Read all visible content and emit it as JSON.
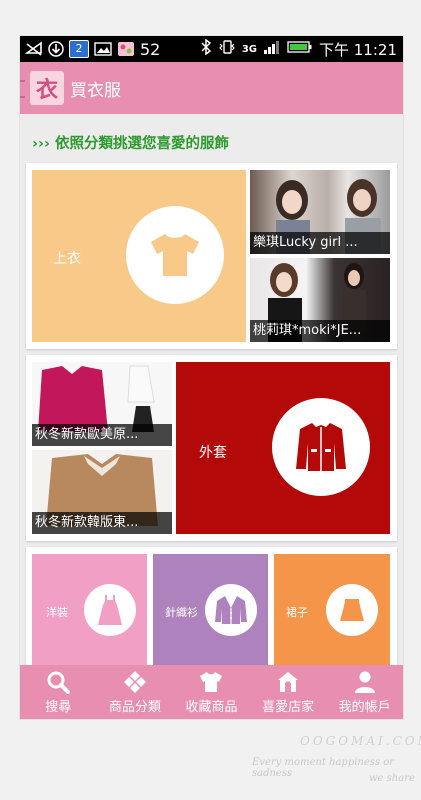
{
  "status_bar": {
    "battery_text": "52",
    "signal_label": "3G",
    "time": "下午 11:21",
    "notification_count": "2"
  },
  "app": {
    "title": "買衣服",
    "logo_char": "衣"
  },
  "section": {
    "title": "››› 依照分類挑選您喜愛的服飾"
  },
  "categories": {
    "tops": {
      "label": "上衣",
      "color": "#f9c98a",
      "shop1_caption": "樂琪Lucky girl ...",
      "shop2_caption": "桃莉琪*moki*JE..."
    },
    "jackets": {
      "label": "外套",
      "color": "#b30909",
      "shop1_caption": "秋冬新款歐美原...",
      "shop2_caption": "秋冬新款韓版東..."
    },
    "dresses": {
      "label": "洋裝",
      "color": "#f29fc6"
    },
    "cardigans": {
      "label": "針織衫",
      "color": "#ad82bd"
    },
    "skirts": {
      "label": "裙子",
      "color": "#f5954a"
    }
  },
  "bottom_nav": [
    {
      "label": "搜尋",
      "icon": "search-icon"
    },
    {
      "label": "商品分類",
      "icon": "categories-icon"
    },
    {
      "label": "收藏商品",
      "icon": "shirt-icon"
    },
    {
      "label": "喜愛店家",
      "icon": "store-icon"
    },
    {
      "label": "我的帳戶",
      "icon": "person-icon"
    }
  ],
  "watermark": {
    "site": "OOGOMAI.COM",
    "line1": "Every moment happiness or sadness",
    "line2": "we share"
  },
  "colors": {
    "accent": "#e88fb1",
    "section_title": "#2f9a2f"
  }
}
